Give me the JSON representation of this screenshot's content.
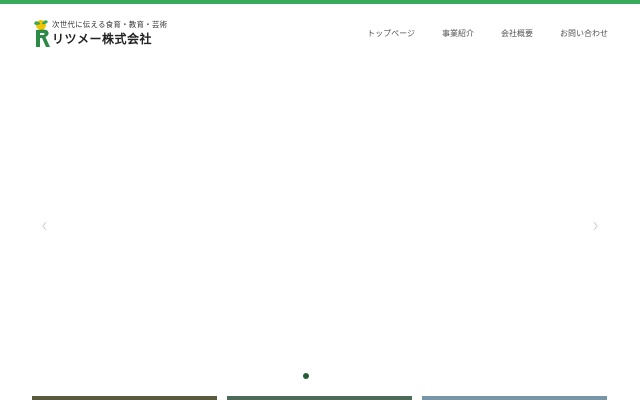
{
  "brand": {
    "tagline": "次世代に伝える食育・教育・芸術",
    "name": "リツメー株式会社",
    "logo_icon": "r-seedling-logo",
    "green": "#3aaa5a",
    "yellow": "#f2c400"
  },
  "nav": {
    "items": [
      {
        "label": "トップページ"
      },
      {
        "label": "事業紹介"
      },
      {
        "label": "会社概要"
      },
      {
        "label": "お問い合わせ"
      }
    ]
  },
  "slider": {
    "prev_icon": "chevron-left-icon",
    "next_icon": "chevron-right-icon",
    "dot_color": "#245c35"
  },
  "thumbnails": {
    "colors": [
      "#5a5a3e",
      "#4e6a58",
      "#7896a8"
    ]
  }
}
